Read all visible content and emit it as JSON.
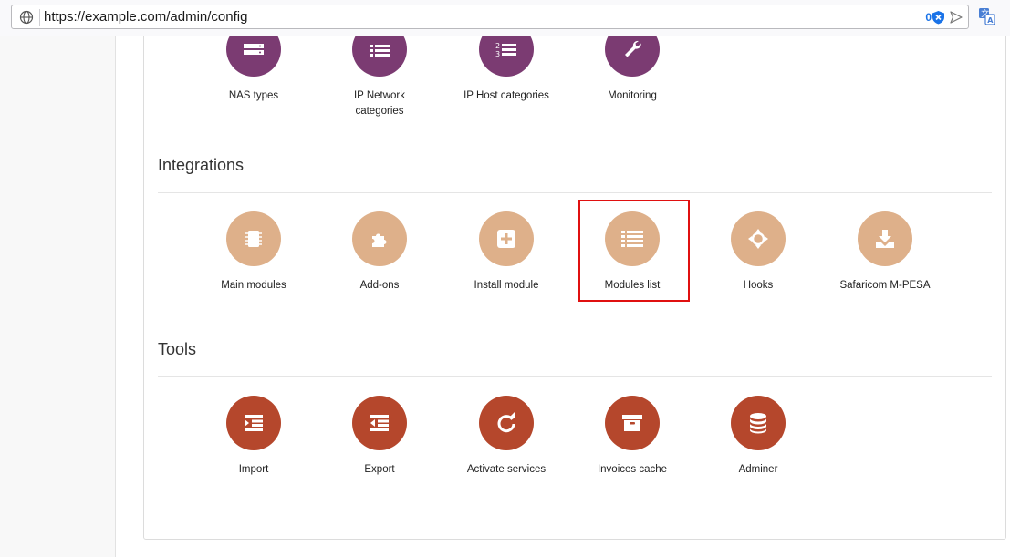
{
  "browser": {
    "url": "https://example.com/admin/config",
    "badge_count": "0"
  },
  "top_row": [
    {
      "label": "NAS types",
      "icon": "server-icon"
    },
    {
      "label": "IP Network categories",
      "icon": "list-icon"
    },
    {
      "label": "IP Host categories",
      "icon": "numbered-list-icon"
    },
    {
      "label": "Monitoring",
      "icon": "wrench-icon"
    }
  ],
  "integrations": {
    "title": "Integrations",
    "items": [
      {
        "label": "Main modules",
        "icon": "chip-icon"
      },
      {
        "label": "Add-ons",
        "icon": "puzzle-icon"
      },
      {
        "label": "Install module",
        "icon": "plus-square-icon"
      },
      {
        "label": "Modules list",
        "icon": "list-icon"
      },
      {
        "label": "Hooks",
        "icon": "crosshair-icon"
      },
      {
        "label": "Safaricom M-PESA",
        "icon": "download-icon"
      }
    ]
  },
  "tools": {
    "title": "Tools",
    "items": [
      {
        "label": "Import",
        "icon": "import-icon"
      },
      {
        "label": "Export",
        "icon": "export-icon"
      },
      {
        "label": "Activate services",
        "icon": "refresh-icon"
      },
      {
        "label": "Invoices cache",
        "icon": "archive-icon"
      },
      {
        "label": "Adminer",
        "icon": "database-icon"
      }
    ]
  },
  "colors": {
    "purple": "#7b3b72",
    "tan": "#deb08a",
    "rust": "#b5472c",
    "highlight": "#e01010"
  }
}
